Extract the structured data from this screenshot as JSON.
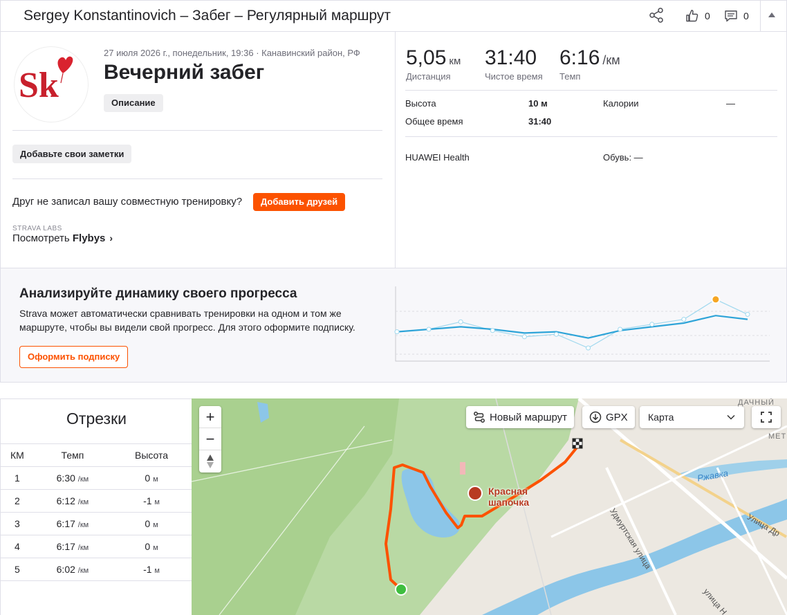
{
  "header": {
    "title": "Sergey Konstantinovich – Забег – Регулярный маршрут",
    "kudos_count": "0",
    "comments_count": "0"
  },
  "activity": {
    "avatar_text": "Sk",
    "date_line": "27 июля 2026 г., понедельник, 19:36 · Канавинский район, РФ",
    "name": "Вечерний забег",
    "description_button": "Описание",
    "notes_button": "Добавьте свои заметки",
    "friend_question": "Друг не записал вашу совместную тренировку?",
    "add_friends_button": "Добавить друзей",
    "labs_label": "STRAVA LABS",
    "flybys_prefix": "Посмотреть ",
    "flybys_bold": "Flybys"
  },
  "stats": {
    "distance": {
      "value": "5,05",
      "unit": "км",
      "label": "Дистанция"
    },
    "moving_time": {
      "value": "31:40",
      "label": "Чистое время"
    },
    "pace": {
      "value": "6:16",
      "unit": "/км",
      "label": "Темп"
    },
    "elevation_label": "Высота",
    "elevation_value": "10 м",
    "elapsed_label": "Общее время",
    "elapsed_value": "31:40",
    "calories_label": "Калории",
    "calories_value": "—",
    "device": "HUAWEI Health",
    "shoes": "Обувь: —"
  },
  "promo": {
    "title": "Анализируйте динамику своего прогресса",
    "text_brand": "Strava",
    "text_rest": " может автоматически сравнивать тренировки на одном и том же маршруте, чтобы вы видели свой прогресс. Для этого оформите подписку.",
    "subscribe_button": "Оформить подписку",
    "chart": {
      "line_a": [
        3.2,
        3.0,
        2.8,
        3.0,
        3.3,
        3.2,
        3.7,
        3.1,
        2.8,
        2.5,
        1.9,
        2.2
      ],
      "line_b": [
        3.2,
        3.0,
        2.4,
        3.1,
        3.6,
        3.4,
        4.5,
        3.0,
        2.6,
        2.2,
        0.6,
        1.8
      ],
      "highlight_index": 10
    }
  },
  "splits": {
    "title": "Отрезки",
    "headers": [
      "КМ",
      "Темп",
      "Высота"
    ],
    "pace_unit": "/км",
    "elev_unit": "м",
    "rows": [
      {
        "km": "1",
        "pace": "6:30",
        "elev": "0"
      },
      {
        "km": "2",
        "pace": "6:12",
        "elev": "-1"
      },
      {
        "km": "3",
        "pace": "6:17",
        "elev": "0"
      },
      {
        "km": "4",
        "pace": "6:17",
        "elev": "0"
      },
      {
        "km": "5",
        "pace": "6:02",
        "elev": "-1"
      }
    ]
  },
  "map": {
    "new_route_button": "Новый маршрут",
    "gpx_button": "GPX",
    "map_type": "Карта",
    "poi_name_line1": "Красная",
    "poi_name_line2": "шапочка",
    "label_dachny": "ДАЧНЫЙ",
    "label_met": "МЕТ",
    "label_rzhavka": "Ржавка",
    "label_udmurt": "Удмуртская улица",
    "label_ulitsa_dr": "Улица Др",
    "label_ulitsa_n": "улица Н",
    "route_color": "#fc5200"
  }
}
